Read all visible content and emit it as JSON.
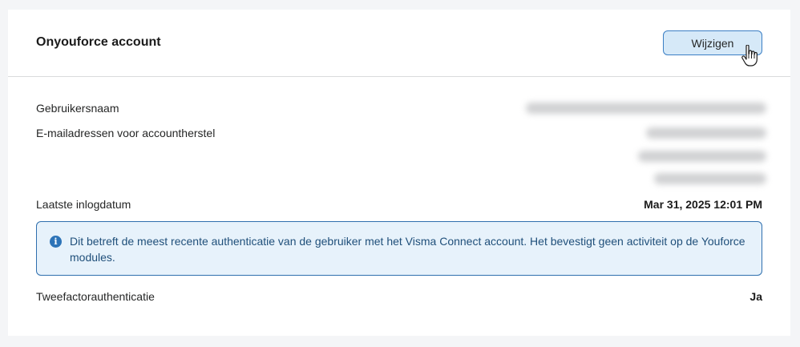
{
  "card": {
    "title": "Onyouforce account",
    "edit_label": "Wijzigen"
  },
  "rows": {
    "username_label": "Gebruikersnaam",
    "recovery_emails_label": "E-mailadressen voor accountherstel",
    "last_login_label": "Laatste inlogdatum",
    "last_login_value": "Mar 31, 2025 12:01 PM",
    "two_factor_label": "Tweefactorauthenticatie",
    "two_factor_value": "Ja"
  },
  "info": {
    "icon": "info-icon",
    "text": "Dit betreft de meest recente authenticatie van de gebruiker met het Visma Connect account. Het bevestigt geen activiteit op de Youforce modules."
  },
  "colors": {
    "accent": "#3b7fc4",
    "button_bg": "#d6e9f8",
    "info_bg": "#e7f2fb",
    "info_border": "#2f6fae",
    "info_text": "#1f4f7a"
  }
}
